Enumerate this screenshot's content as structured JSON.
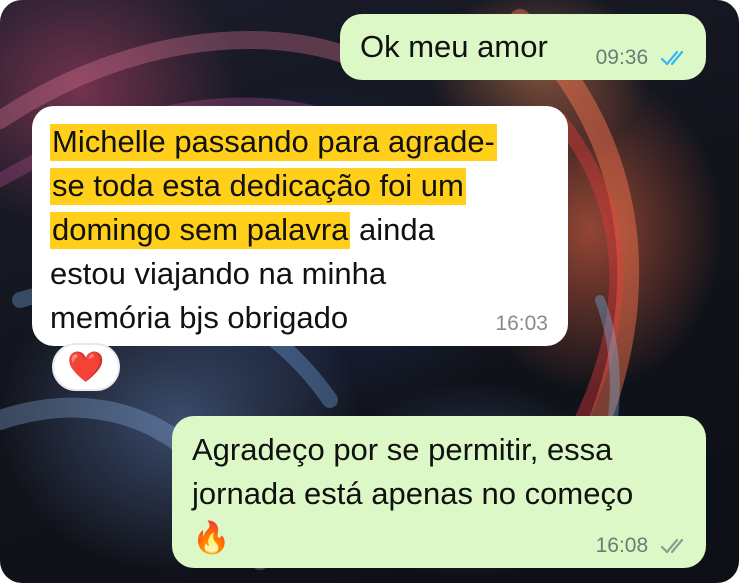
{
  "messages": [
    {
      "direction": "outgoing",
      "text": "Ok meu amor",
      "time": "09:36",
      "status": "read",
      "status_color": "#34b7f1"
    },
    {
      "direction": "incoming",
      "lines": {
        "l1": "Michelle passando para agrade-",
        "l2": "se toda esta dedicação foi um",
        "l3_highlight": "domingo sem palavra",
        "l3_rest": " ainda",
        "l4": "estou viajando na minha",
        "l5": "memória bjs obrigado"
      },
      "highlight_color": "#ffcf1a",
      "time": "16:03",
      "reaction": "❤️"
    },
    {
      "direction": "outgoing",
      "lines": {
        "l1": "Agradeço por se permitir, essa",
        "l2": "jornada está apenas no começo",
        "l3": "🔥"
      },
      "time": "16:08",
      "status": "delivered",
      "status_color": "#8e9a93"
    }
  ],
  "colors": {
    "outgoing_bubble": "#dcf8c6",
    "incoming_bubble": "#ffffff"
  }
}
